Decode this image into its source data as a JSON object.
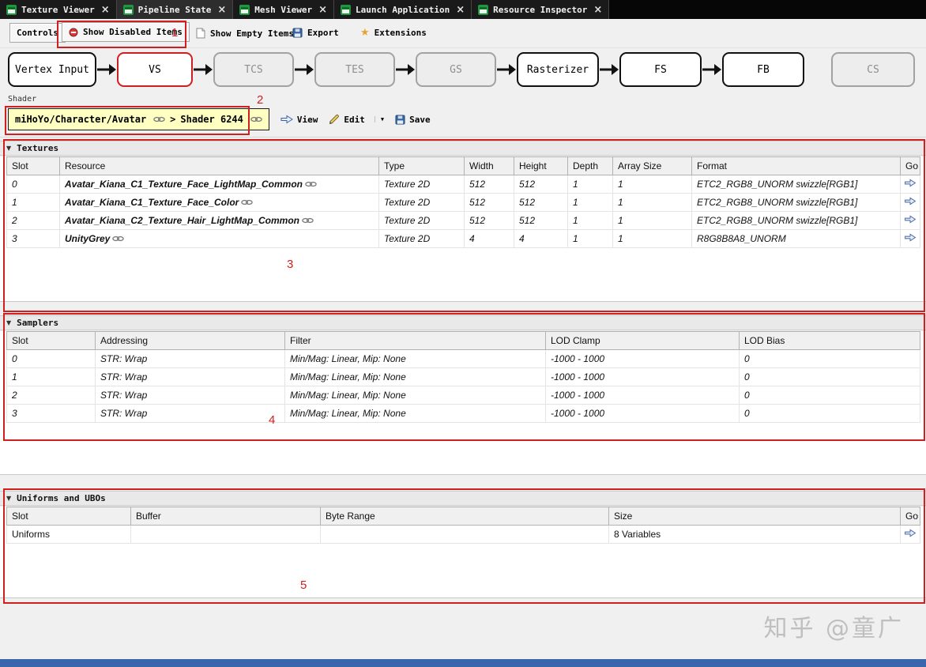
{
  "glyphs": {
    "close": "×",
    "triangle": "▼",
    "caret": "▼",
    "star": "★"
  },
  "colors": {
    "annotation_red": "#cf1f1f",
    "highlight_yellow": "#ffffc2",
    "tab_icon_green": "#21953f",
    "bottom_bar_blue": "#3a66ad"
  },
  "tabs": [
    {
      "label": "Texture Viewer"
    },
    {
      "label": "Pipeline State"
    },
    {
      "label": "Mesh Viewer"
    },
    {
      "label": "Launch Application"
    },
    {
      "label": "Resource Inspector"
    }
  ],
  "toolbar": {
    "controls_label": "Controls",
    "show_disabled_label": "Show Disabled Items",
    "show_empty_label": "Show Empty Items",
    "export_label": "Export",
    "extensions_label": "Extensions"
  },
  "pipeline": {
    "stages": [
      {
        "label": "Vertex Input"
      },
      {
        "label": "VS"
      },
      {
        "label": "TCS"
      },
      {
        "label": "TES"
      },
      {
        "label": "GS"
      },
      {
        "label": "Rasterizer"
      },
      {
        "label": "FS"
      },
      {
        "label": "FB"
      },
      {
        "label": "CS"
      }
    ]
  },
  "shader": {
    "caption": "Shader",
    "path": "miHoYo/Character/Avatar",
    "separator": ">",
    "name": "Shader 6244",
    "view_label": "View",
    "edit_label": "Edit",
    "save_label": "Save"
  },
  "textures": {
    "title": "Textures",
    "columns": {
      "slot": "Slot",
      "resource": "Resource",
      "type": "Type",
      "width": "Width",
      "height": "Height",
      "depth": "Depth",
      "array_size": "Array Size",
      "format": "Format",
      "go": "Go"
    },
    "rows": [
      {
        "slot": "0",
        "resource": "Avatar_Kiana_C1_Texture_Face_LightMap_Common",
        "type": "Texture 2D",
        "width": "512",
        "height": "512",
        "depth": "1",
        "array_size": "1",
        "format": "ETC2_RGB8_UNORM swizzle[RGB1]"
      },
      {
        "slot": "1",
        "resource": "Avatar_Kiana_C1_Texture_Face_Color",
        "type": "Texture 2D",
        "width": "512",
        "height": "512",
        "depth": "1",
        "array_size": "1",
        "format": "ETC2_RGB8_UNORM swizzle[RGB1]"
      },
      {
        "slot": "2",
        "resource": "Avatar_Kiana_C2_Texture_Hair_LightMap_Common",
        "type": "Texture 2D",
        "width": "512",
        "height": "512",
        "depth": "1",
        "array_size": "1",
        "format": "ETC2_RGB8_UNORM swizzle[RGB1]"
      },
      {
        "slot": "3",
        "resource": "UnityGrey",
        "type": "Texture 2D",
        "width": "4",
        "height": "4",
        "depth": "1",
        "array_size": "1",
        "format": "R8G8B8A8_UNORM"
      }
    ]
  },
  "samplers": {
    "title": "Samplers",
    "columns": {
      "slot": "Slot",
      "addressing": "Addressing",
      "filter": "Filter",
      "lod_clamp": "LOD Clamp",
      "lod_bias": "LOD Bias"
    },
    "rows": [
      {
        "slot": "0",
        "addressing": "STR: Wrap",
        "filter": "Min/Mag: Linear, Mip: None",
        "lod_clamp": "-1000 - 1000",
        "lod_bias": "0"
      },
      {
        "slot": "1",
        "addressing": "STR: Wrap",
        "filter": "Min/Mag: Linear, Mip: None",
        "lod_clamp": "-1000 - 1000",
        "lod_bias": "0"
      },
      {
        "slot": "2",
        "addressing": "STR: Wrap",
        "filter": "Min/Mag: Linear, Mip: None",
        "lod_clamp": "-1000 - 1000",
        "lod_bias": "0"
      },
      {
        "slot": "3",
        "addressing": "STR: Wrap",
        "filter": "Min/Mag: Linear, Mip: None",
        "lod_clamp": "-1000 - 1000",
        "lod_bias": "0"
      }
    ]
  },
  "uniforms": {
    "title": "Uniforms and UBOs",
    "columns": {
      "slot": "Slot",
      "buffer": "Buffer",
      "byte_range": "Byte Range",
      "size": "Size",
      "go": "Go"
    },
    "rows": [
      {
        "slot": "Uniforms",
        "buffer": "",
        "byte_range": "",
        "size": "8 Variables"
      }
    ]
  },
  "annotations": {
    "n1": "1",
    "n2": "2",
    "n3": "3",
    "n4": "4",
    "n5": "5"
  },
  "watermark": "知乎 @童广"
}
